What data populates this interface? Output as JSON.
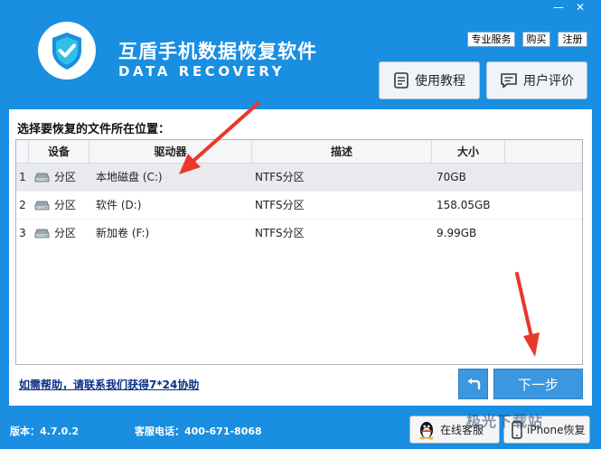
{
  "window": {
    "minimize_glyph": "—",
    "close_glyph": "✕"
  },
  "header": {
    "title": "互盾手机数据恢复软件",
    "subtitle": "DATA RECOVERY",
    "logo_icon": "shield-check-icon",
    "links": {
      "service": "专业服务",
      "buy": "购买",
      "register": "注册"
    },
    "tutorial_label": "使用教程",
    "review_label": "用户评价"
  },
  "main": {
    "prompt": "选择要恢复的文件所在位置：",
    "table": {
      "headers": {
        "device": "设备",
        "drive": "驱动器",
        "desc": "描述",
        "size": "大小"
      },
      "rows": [
        {
          "index": "1",
          "device": "分区",
          "drive": "本地磁盘 (C:)",
          "desc": "NTFS分区",
          "size": "70GB",
          "selected": true
        },
        {
          "index": "2",
          "device": "分区",
          "drive": "软件 (D:)",
          "desc": "NTFS分区",
          "size": "158.05GB",
          "selected": false
        },
        {
          "index": "3",
          "device": "分区",
          "drive": "新加卷 (F:)",
          "desc": "NTFS分区",
          "size": "9.99GB",
          "selected": false
        }
      ]
    },
    "help_link": "如需帮助，请联系我们获得7*24协助",
    "back_glyph": "↰",
    "next_label": "下一步"
  },
  "footer": {
    "version": "版本：4.7.0.2",
    "phone": "客服电话：400-671-8068",
    "support_label": "在线客服",
    "iphone_label": "iPhone恢复"
  },
  "watermark": "极光下载站",
  "colors": {
    "accent": "#1a8ee1",
    "annotation_arrow": "#e8382b"
  }
}
